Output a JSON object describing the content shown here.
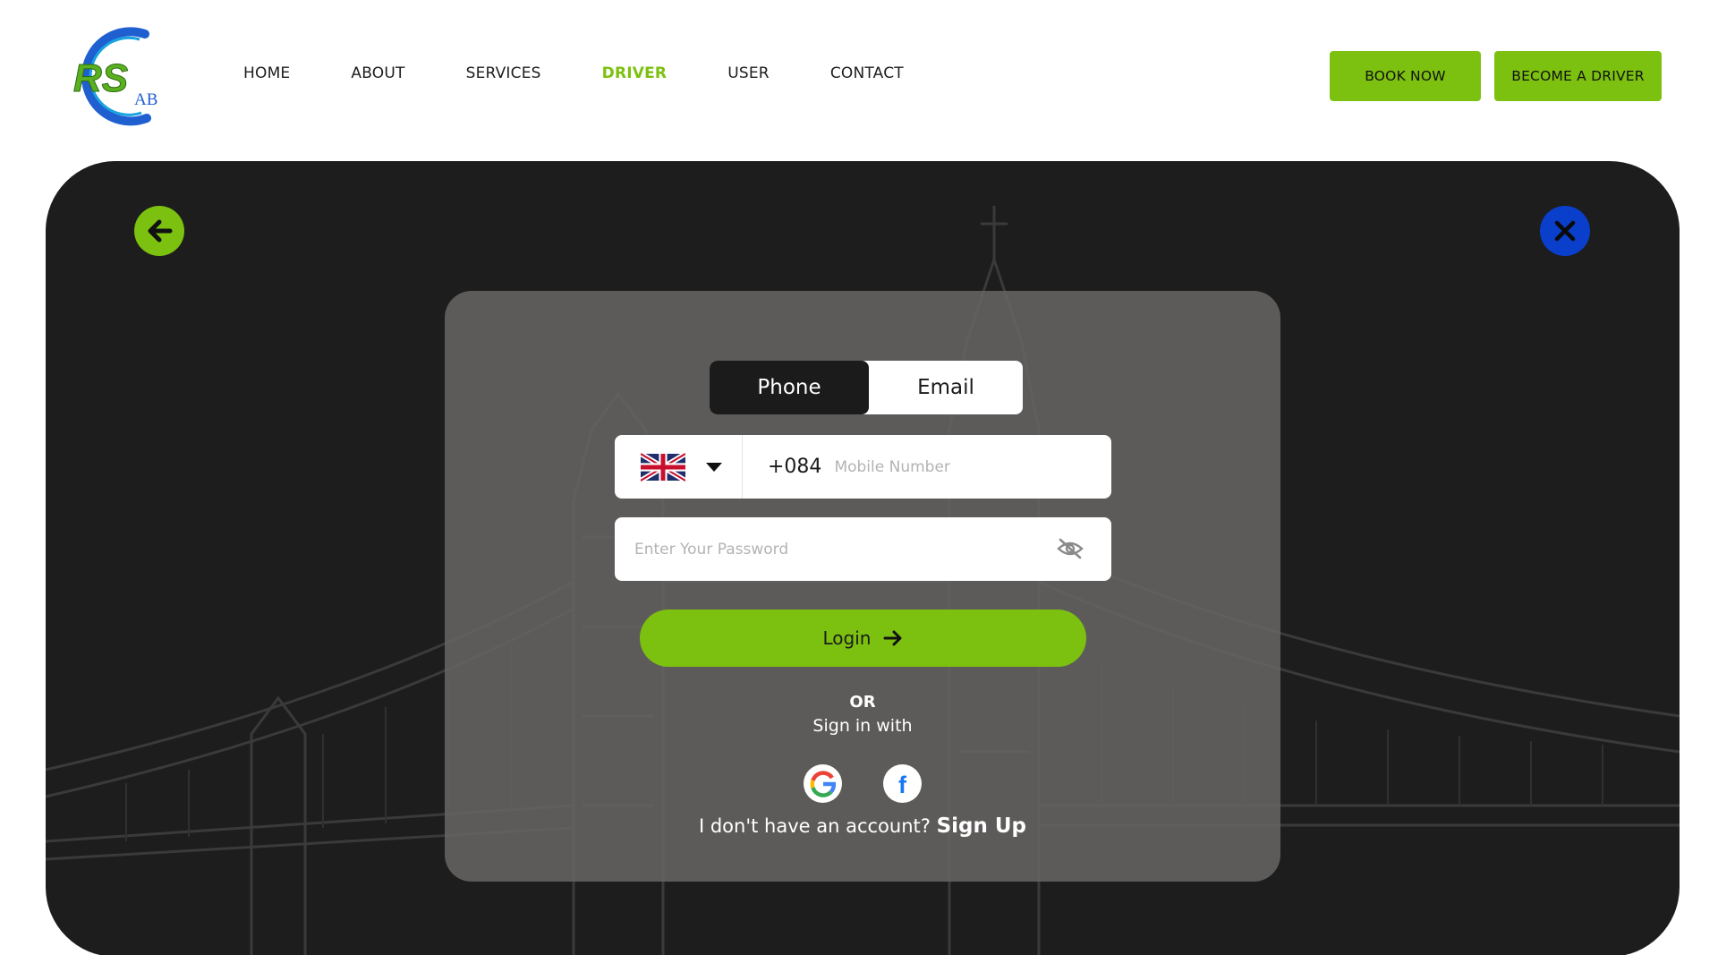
{
  "logo": {
    "text": "RS",
    "suffix": "AB"
  },
  "nav": {
    "items": [
      {
        "label": "HOME",
        "active": false
      },
      {
        "label": "ABOUT",
        "active": false
      },
      {
        "label": "SERVICES",
        "active": false
      },
      {
        "label": "DRIVER",
        "active": true
      },
      {
        "label": "USER",
        "active": false
      },
      {
        "label": "CONTACT",
        "active": false
      }
    ]
  },
  "header": {
    "book_now_label": "BOOK NOW",
    "become_driver_label": "BECOME A DRIVER"
  },
  "controls": {
    "back_icon": "arrow-left-icon",
    "close_icon": "close-icon"
  },
  "login": {
    "tabs": [
      {
        "label": "Phone",
        "active": true
      },
      {
        "label": "Email",
        "active": false
      }
    ],
    "phone": {
      "country_flag": "uk-flag-icon",
      "dial_code": "+084",
      "placeholder": "Mobile Number"
    },
    "password": {
      "placeholder": "Enter Your Password",
      "toggle_icon": "eye-off-icon"
    },
    "submit_label": "Login",
    "or_label": "OR",
    "sign_in_with": "Sign in with",
    "social": [
      "google-icon",
      "facebook-icon"
    ],
    "no_account_text": "I don't have an account?",
    "signup_label": "Sign Up"
  },
  "colors": {
    "accent": "#7cc10f",
    "close_button": "#0a3fcc",
    "hero_background": "#1d1d1d",
    "card_background": "#686564"
  }
}
